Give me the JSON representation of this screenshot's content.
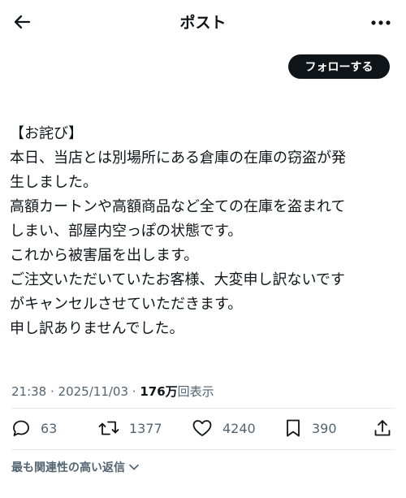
{
  "header": {
    "title": "ポスト",
    "back_icon": "arrow-left-icon",
    "more_icon": "more-dots-icon"
  },
  "follow_button": {
    "label": "フォローする"
  },
  "post": {
    "lines": [
      "【お詫び】",
      "本日、当店とは別場所にある倉庫の在庫の窃盗が発",
      "生しました。",
      "高額カートンや高額商品など全ての在庫を盗まれて",
      "しまい、部屋内空っぽの状態です。",
      "これから被害届を出します。",
      "ご注文いただいていたお客様、大変申し訳ないです",
      "がキャンセルさせていただきます。",
      "申し訳ありませんでした。"
    ]
  },
  "meta": {
    "time": "21:38",
    "separator": " · ",
    "date": "2025/11/03",
    "views_count": "176万",
    "views_label": "回表示"
  },
  "actions": {
    "reply": {
      "icon": "reply-icon",
      "count": "63"
    },
    "repost": {
      "icon": "repost-icon",
      "count": "1377"
    },
    "like": {
      "icon": "heart-icon",
      "count": "4240"
    },
    "bookmark": {
      "icon": "bookmark-icon",
      "count": "390"
    },
    "share": {
      "icon": "share-icon"
    }
  },
  "replies_sort": {
    "label": "最も関連性の高い返信"
  },
  "colors": {
    "text": "#0f1419",
    "secondary": "#536471",
    "divider": "#e6e9ec",
    "button_bg": "#0f1419"
  }
}
